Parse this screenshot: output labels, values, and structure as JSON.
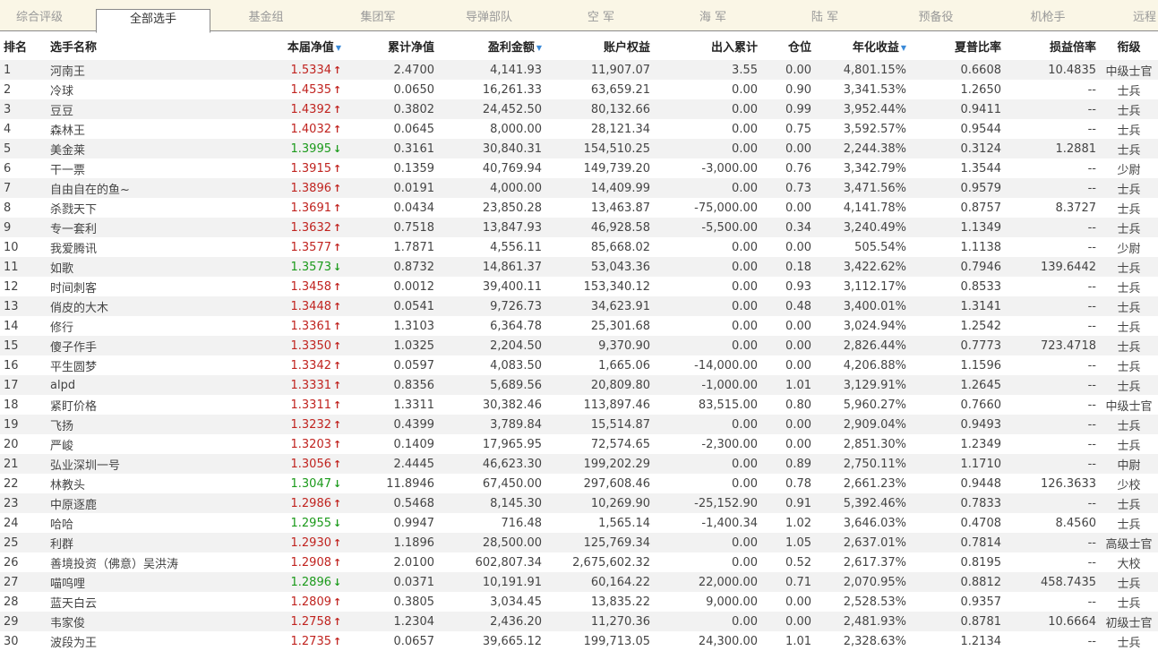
{
  "tabs": [
    {
      "label": "综合评级",
      "active": false
    },
    {
      "label": "全部选手",
      "active": true
    },
    {
      "label": "基金组",
      "active": false
    },
    {
      "label": "集团军",
      "active": false
    },
    {
      "label": "导弹部队",
      "active": false
    },
    {
      "label": "空  军",
      "active": false
    },
    {
      "label": "海  军",
      "active": false
    },
    {
      "label": "陆  军",
      "active": false
    },
    {
      "label": "预备役",
      "active": false
    },
    {
      "label": "机枪手",
      "active": false
    },
    {
      "label": "远程",
      "active": false
    }
  ],
  "columns": {
    "rank": "排名",
    "name": "选手名称",
    "nav": "本届净值",
    "cum_nav": "累计净值",
    "profit": "盈利金额",
    "equity": "账户权益",
    "inout": "出入累计",
    "position": "仓位",
    "annual": "年化收益",
    "sharpe": "夏普比率",
    "pl_ratio": "损益倍率",
    "title": "衔级"
  },
  "colors": {
    "up": "#c0231f",
    "down": "#1b9a1b",
    "sort_indicator": "#3a8ad8"
  },
  "rows": [
    {
      "rank": "1",
      "name": "河南王",
      "nav": "1.5334",
      "dir": "up",
      "cum_nav": "2.4700",
      "profit": "4,141.93",
      "equity": "11,907.07",
      "inout": "3.55",
      "position": "0.00",
      "annual": "4,801.15%",
      "sharpe": "0.6608",
      "pl_ratio": "10.4835",
      "title": "中级士官"
    },
    {
      "rank": "2",
      "name": "冷球",
      "nav": "1.4535",
      "dir": "up",
      "cum_nav": "0.0650",
      "profit": "16,261.33",
      "equity": "63,659.21",
      "inout": "0.00",
      "position": "0.90",
      "annual": "3,341.53%",
      "sharpe": "1.2650",
      "pl_ratio": "--",
      "title": "士兵"
    },
    {
      "rank": "3",
      "name": "豆豆",
      "nav": "1.4392",
      "dir": "up",
      "cum_nav": "0.3802",
      "profit": "24,452.50",
      "equity": "80,132.66",
      "inout": "0.00",
      "position": "0.99",
      "annual": "3,952.44%",
      "sharpe": "0.9411",
      "pl_ratio": "--",
      "title": "士兵"
    },
    {
      "rank": "4",
      "name": "森林王",
      "nav": "1.4032",
      "dir": "up",
      "cum_nav": "0.0645",
      "profit": "8,000.00",
      "equity": "28,121.34",
      "inout": "0.00",
      "position": "0.75",
      "annual": "3,592.57%",
      "sharpe": "0.9544",
      "pl_ratio": "--",
      "title": "士兵"
    },
    {
      "rank": "5",
      "name": "美金莱",
      "nav": "1.3995",
      "dir": "down",
      "cum_nav": "0.3161",
      "profit": "30,840.31",
      "equity": "154,510.25",
      "inout": "0.00",
      "position": "0.00",
      "annual": "2,244.38%",
      "sharpe": "0.3124",
      "pl_ratio": "1.2881",
      "title": "士兵"
    },
    {
      "rank": "6",
      "name": "干一票",
      "nav": "1.3915",
      "dir": "up",
      "cum_nav": "0.1359",
      "profit": "40,769.94",
      "equity": "149,739.20",
      "inout": "-3,000.00",
      "position": "0.76",
      "annual": "3,342.79%",
      "sharpe": "1.3544",
      "pl_ratio": "--",
      "title": "少尉"
    },
    {
      "rank": "7",
      "name": "自由自在的鱼~",
      "nav": "1.3896",
      "dir": "up",
      "cum_nav": "0.0191",
      "profit": "4,000.00",
      "equity": "14,409.99",
      "inout": "0.00",
      "position": "0.73",
      "annual": "3,471.56%",
      "sharpe": "0.9579",
      "pl_ratio": "--",
      "title": "士兵"
    },
    {
      "rank": "8",
      "name": "杀戮天下",
      "nav": "1.3691",
      "dir": "up",
      "cum_nav": "0.0434",
      "profit": "23,850.28",
      "equity": "13,463.87",
      "inout": "-75,000.00",
      "position": "0.00",
      "annual": "4,141.78%",
      "sharpe": "0.8757",
      "pl_ratio": "8.3727",
      "title": "士兵"
    },
    {
      "rank": "9",
      "name": "专一套利",
      "nav": "1.3632",
      "dir": "up",
      "cum_nav": "0.7518",
      "profit": "13,847.93",
      "equity": "46,928.58",
      "inout": "-5,500.00",
      "position": "0.34",
      "annual": "3,240.49%",
      "sharpe": "1.1349",
      "pl_ratio": "--",
      "title": "士兵"
    },
    {
      "rank": "10",
      "name": "我爱腾讯",
      "nav": "1.3577",
      "dir": "up",
      "cum_nav": "1.7871",
      "profit": "4,556.11",
      "equity": "85,668.02",
      "inout": "0.00",
      "position": "0.00",
      "annual": "505.54%",
      "sharpe": "1.1138",
      "pl_ratio": "--",
      "title": "少尉"
    },
    {
      "rank": "11",
      "name": "如歌",
      "nav": "1.3573",
      "dir": "down",
      "cum_nav": "0.8732",
      "profit": "14,861.37",
      "equity": "53,043.36",
      "inout": "0.00",
      "position": "0.18",
      "annual": "3,422.62%",
      "sharpe": "0.7946",
      "pl_ratio": "139.6442",
      "title": "士兵"
    },
    {
      "rank": "12",
      "name": "时间刺客",
      "nav": "1.3458",
      "dir": "up",
      "cum_nav": "0.0012",
      "profit": "39,400.11",
      "equity": "153,340.12",
      "inout": "0.00",
      "position": "0.93",
      "annual": "3,112.17%",
      "sharpe": "0.8533",
      "pl_ratio": "--",
      "title": "士兵"
    },
    {
      "rank": "13",
      "name": "俏皮的大木",
      "nav": "1.3448",
      "dir": "up",
      "cum_nav": "0.0541",
      "profit": "9,726.73",
      "equity": "34,623.91",
      "inout": "0.00",
      "position": "0.48",
      "annual": "3,400.01%",
      "sharpe": "1.3141",
      "pl_ratio": "--",
      "title": "士兵"
    },
    {
      "rank": "14",
      "name": "修行",
      "nav": "1.3361",
      "dir": "up",
      "cum_nav": "1.3103",
      "profit": "6,364.78",
      "equity": "25,301.68",
      "inout": "0.00",
      "position": "0.00",
      "annual": "3,024.94%",
      "sharpe": "1.2542",
      "pl_ratio": "--",
      "title": "士兵"
    },
    {
      "rank": "15",
      "name": "傻子作手",
      "nav": "1.3350",
      "dir": "up",
      "cum_nav": "1.0325",
      "profit": "2,204.50",
      "equity": "9,370.90",
      "inout": "0.00",
      "position": "0.00",
      "annual": "2,826.44%",
      "sharpe": "0.7773",
      "pl_ratio": "723.4718",
      "title": "士兵"
    },
    {
      "rank": "16",
      "name": "平生圆梦",
      "nav": "1.3342",
      "dir": "up",
      "cum_nav": "0.0597",
      "profit": "4,083.50",
      "equity": "1,665.06",
      "inout": "-14,000.00",
      "position": "0.00",
      "annual": "4,206.88%",
      "sharpe": "1.1596",
      "pl_ratio": "--",
      "title": "士兵"
    },
    {
      "rank": "17",
      "name": "alpd",
      "nav": "1.3331",
      "dir": "up",
      "cum_nav": "0.8356",
      "profit": "5,689.56",
      "equity": "20,809.80",
      "inout": "-1,000.00",
      "position": "1.01",
      "annual": "3,129.91%",
      "sharpe": "1.2645",
      "pl_ratio": "--",
      "title": "士兵"
    },
    {
      "rank": "18",
      "name": "紧盯价格",
      "nav": "1.3311",
      "dir": "up",
      "cum_nav": "1.3311",
      "profit": "30,382.46",
      "equity": "113,897.46",
      "inout": "83,515.00",
      "position": "0.80",
      "annual": "5,960.27%",
      "sharpe": "0.7660",
      "pl_ratio": "--",
      "title": "中级士官"
    },
    {
      "rank": "19",
      "name": "飞扬",
      "nav": "1.3232",
      "dir": "up",
      "cum_nav": "0.4399",
      "profit": "3,789.84",
      "equity": "15,514.87",
      "inout": "0.00",
      "position": "0.00",
      "annual": "2,909.04%",
      "sharpe": "0.9493",
      "pl_ratio": "--",
      "title": "士兵"
    },
    {
      "rank": "20",
      "name": "严峻",
      "nav": "1.3203",
      "dir": "up",
      "cum_nav": "0.1409",
      "profit": "17,965.95",
      "equity": "72,574.65",
      "inout": "-2,300.00",
      "position": "0.00",
      "annual": "2,851.30%",
      "sharpe": "1.2349",
      "pl_ratio": "--",
      "title": "士兵"
    },
    {
      "rank": "21",
      "name": "弘业深圳一号",
      "nav": "1.3056",
      "dir": "up",
      "cum_nav": "2.4445",
      "profit": "46,623.30",
      "equity": "199,202.29",
      "inout": "0.00",
      "position": "0.89",
      "annual": "2,750.11%",
      "sharpe": "1.1710",
      "pl_ratio": "--",
      "title": "中尉"
    },
    {
      "rank": "22",
      "name": "林教头",
      "nav": "1.3047",
      "dir": "down",
      "cum_nav": "11.8946",
      "profit": "67,450.00",
      "equity": "297,608.46",
      "inout": "0.00",
      "position": "0.78",
      "annual": "2,661.23%",
      "sharpe": "0.9448",
      "pl_ratio": "126.3633",
      "title": "少校"
    },
    {
      "rank": "23",
      "name": "中原逐鹿",
      "nav": "1.2986",
      "dir": "up",
      "cum_nav": "0.5468",
      "profit": "8,145.30",
      "equity": "10,269.90",
      "inout": "-25,152.90",
      "position": "0.91",
      "annual": "5,392.46%",
      "sharpe": "0.7833",
      "pl_ratio": "--",
      "title": "士兵"
    },
    {
      "rank": "24",
      "name": "哈哈",
      "nav": "1.2955",
      "dir": "down",
      "cum_nav": "0.9947",
      "profit": "716.48",
      "equity": "1,565.14",
      "inout": "-1,400.34",
      "position": "1.02",
      "annual": "3,646.03%",
      "sharpe": "0.4708",
      "pl_ratio": "8.4560",
      "title": "士兵"
    },
    {
      "rank": "25",
      "name": "利群",
      "nav": "1.2930",
      "dir": "up",
      "cum_nav": "1.1896",
      "profit": "28,500.00",
      "equity": "125,769.34",
      "inout": "0.00",
      "position": "1.05",
      "annual": "2,637.01%",
      "sharpe": "0.7814",
      "pl_ratio": "--",
      "title": "高级士官"
    },
    {
      "rank": "26",
      "name": "善境投资（佛意）吴洪涛",
      "nav": "1.2908",
      "dir": "up",
      "cum_nav": "2.0100",
      "profit": "602,807.34",
      "equity": "2,675,602.32",
      "inout": "0.00",
      "position": "0.52",
      "annual": "2,617.37%",
      "sharpe": "0.8195",
      "pl_ratio": "--",
      "title": "大校"
    },
    {
      "rank": "27",
      "name": "喵呜哩",
      "nav": "1.2896",
      "dir": "down",
      "cum_nav": "0.0371",
      "profit": "10,191.91",
      "equity": "60,164.22",
      "inout": "22,000.00",
      "position": "0.71",
      "annual": "2,070.95%",
      "sharpe": "0.8812",
      "pl_ratio": "458.7435",
      "title": "士兵"
    },
    {
      "rank": "28",
      "name": "蓝天白云",
      "nav": "1.2809",
      "dir": "up",
      "cum_nav": "0.3805",
      "profit": "3,034.45",
      "equity": "13,835.22",
      "inout": "9,000.00",
      "position": "0.00",
      "annual": "2,528.53%",
      "sharpe": "0.9357",
      "pl_ratio": "--",
      "title": "士兵"
    },
    {
      "rank": "29",
      "name": "韦家俊",
      "nav": "1.2758",
      "dir": "up",
      "cum_nav": "1.2304",
      "profit": "2,436.20",
      "equity": "11,270.36",
      "inout": "0.00",
      "position": "0.00",
      "annual": "2,481.93%",
      "sharpe": "0.8781",
      "pl_ratio": "10.6664",
      "title": "初级士官"
    },
    {
      "rank": "30",
      "name": "波段为王",
      "nav": "1.2735",
      "dir": "up",
      "cum_nav": "0.0657",
      "profit": "39,665.12",
      "equity": "199,713.05",
      "inout": "24,300.00",
      "position": "1.01",
      "annual": "2,328.63%",
      "sharpe": "1.2134",
      "pl_ratio": "--",
      "title": "士兵"
    }
  ]
}
